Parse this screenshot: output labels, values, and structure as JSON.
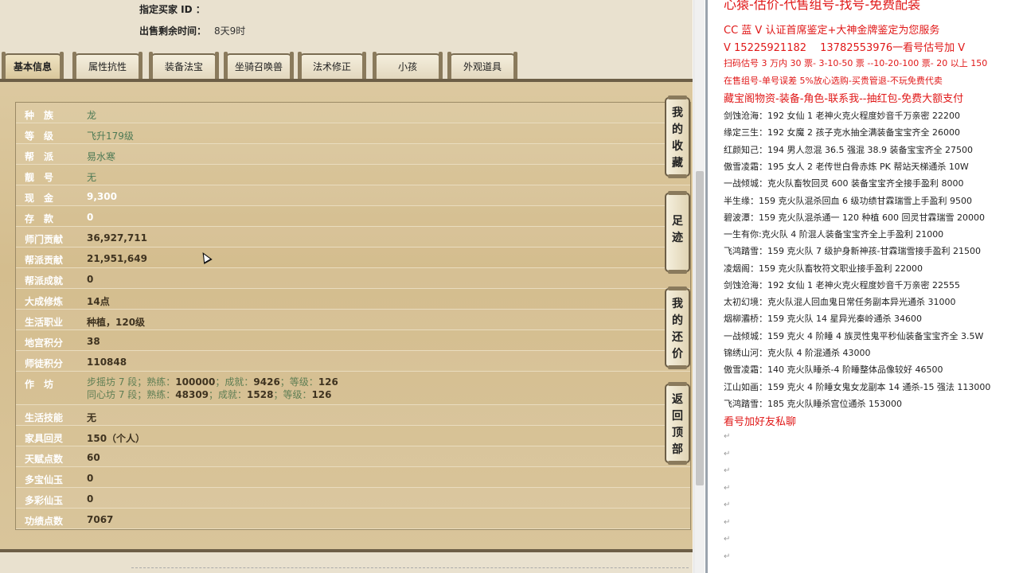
{
  "header": {
    "buyer_label": "指定买家 ID ：",
    "buyer_value": "",
    "remaining_label": "出售剩余时间：",
    "remaining_value": "8天9时"
  },
  "tabs": [
    "基本信息",
    "属性抗性",
    "装备法宝",
    "坐骑召唤兽",
    "法术修正",
    "小孩",
    "外观道具"
  ],
  "info": {
    "race_label": "种　族",
    "race": "龙",
    "level_label": "等　级",
    "level": "飞升179级",
    "sect_label": "帮　派",
    "sect": "易水寒",
    "pretty_label": "靓　号",
    "pretty": "无",
    "cash_label": "现　金",
    "cash": "9,300",
    "deposit_label": "存　款",
    "deposit": "0",
    "school_contrib_label": "师门贡献",
    "school_contrib": "36,927,711",
    "gang_contrib_label": "帮派贡献",
    "gang_contrib": "21,951,649",
    "gang_achieve_label": "帮派成就",
    "gang_achieve": "0",
    "dacheng_label": "大成修炼",
    "dacheng": "14点",
    "life_job_label": "生活职业",
    "life_job": "种植，120级",
    "dungeon_label": "地宫积分",
    "dungeon": "38",
    "mentor_label": "师徒积分",
    "mentor": "110848",
    "workshop_label": "作　坊",
    "workshop1_name": "步摇坊 7 段；熟练：",
    "workshop1_skill": "100000",
    "workshop1_mid": "；成就：",
    "workshop1_achieve": "9426",
    "workshop1_lv": "；等级：",
    "workshop1_level": "126",
    "workshop2_name": "同心坊 7 段；熟练：",
    "workshop2_skill": "48309",
    "workshop2_mid": "；成就：",
    "workshop2_achieve": "1528",
    "workshop2_lv": "；等级：",
    "workshop2_level": "126",
    "life_skill_label": "生活技能",
    "life_skill": "无",
    "home_label": "家具回灵",
    "home": "150（个人）",
    "talent_label": "天赋点数",
    "talent": "60",
    "duobao_label": "多宝仙玉",
    "duobao": "0",
    "duocai_label": "多彩仙玉",
    "duocai": "0",
    "merit_label": "功绩点数",
    "merit": "7067"
  },
  "side_buttons": {
    "collect": [
      "我",
      "的",
      "收",
      "藏"
    ],
    "footprint": [
      "足",
      "迹"
    ],
    "bargain": [
      "我",
      "的",
      "还",
      "价"
    ],
    "top": [
      "返",
      "回",
      "顶",
      "部"
    ]
  },
  "notes": {
    "title": "心猿-估价-代售组号-找号-免费配装",
    "l1": "CC 蓝 V 认证首席鉴定+大神金牌鉴定为您服务",
    "l2": "V 15225921182　 13782553976一看号估号加 V",
    "l3": "扫码估号 3 万内 30 票- 3-10-50 票 --10-20-100 票- 20 以上 150",
    "l4": "在售组号-单号误差 5%放心选购-买贵管退-不玩免费代卖",
    "l5": "藏宝阁物资-装备-角色-联系我--抽红包-免费大额支付",
    "items": [
      "剑蚀沧海：192 女仙 1 老神火克火程度妙音千万亲密 22200",
      "缘定三生：192 女魔 2 孩子克水抽全满装备宝宝齐全 26000",
      "红颜知己：194 男人忽混 36.5 强混 38.9 装备宝宝齐全 27500",
      "傲雪凌霜：195 女人 2 老传世白骨赤炼 PK 帮站天梯通杀 10W",
      "一战倾城：克火队畜牧回灵 600 装备宝宝齐全接手盈利 8000",
      "半生缘：159 克火队混杀回血 6 级功绩甘霖瑞雪上手盈利 9500",
      "碧波潭：159 克火队混杀通一 120 种植 600 回灵甘霖瑞雪 20000",
      "一生有你:克火队 4 阶混人装备宝宝齐全上手盈利 21000",
      "飞鸿踏雪：159 克火队 7 级护身新神孩-甘霖瑞雪接手盈利 21500",
      "凌烟阁：159 克火队畜牧符文职业接手盈利 22000",
      "剑蚀沧海：192 女仙 1 老神火克火程度妙音千万亲密 22555",
      "太初幻境：克火队混人回血鬼日常任务副本异光通杀 31000",
      "烟柳灞桥：159 克火队 14 星异光秦岭通杀 34600",
      "一战倾城：159 克火 4 阶睡 4 族灵性鬼平秒仙装备宝宝齐全 3.5W",
      "锦绣山河：克火队 4 阶混通杀 43000",
      "傲雪凌霜：140 克火队睡杀-4 阶睡整体品像较好 46500",
      "江山如画：159 克火 4 阶睡女鬼女龙副本 14 通杀-15 强法 113000",
      "飞鸿踏雪：185 克火队睡杀宫位通杀 153000"
    ],
    "footer": "看号加好友私聊"
  }
}
